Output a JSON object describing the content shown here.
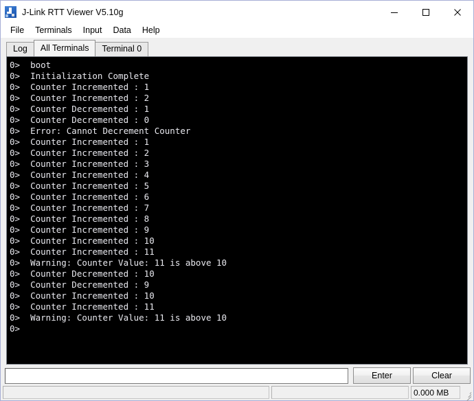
{
  "window": {
    "title": "J-Link RTT Viewer V5.10g",
    "icon": "jlink-logo-icon",
    "controls": {
      "minimize": "minimize-icon",
      "maximize": "maximize-icon",
      "close": "close-icon"
    }
  },
  "menu": {
    "items": [
      {
        "label": "File"
      },
      {
        "label": "Terminals"
      },
      {
        "label": "Input"
      },
      {
        "label": "Data"
      },
      {
        "label": "Help"
      }
    ]
  },
  "tabs": [
    {
      "label": "Log",
      "active": false
    },
    {
      "label": "All Terminals",
      "active": true
    },
    {
      "label": "Terminal 0",
      "active": false
    }
  ],
  "terminal": {
    "background": "#000000",
    "foreground": "#e9e9ef",
    "lines": [
      "0>  boot",
      "0>  Initialization Complete",
      "0>  Counter Incremented : 1",
      "0>  Counter Incremented : 2",
      "0>  Counter Decremented : 1",
      "0>  Counter Decremented : 0",
      "0>  Error: Cannot Decrement Counter",
      "0>  Counter Incremented : 1",
      "0>  Counter Incremented : 2",
      "0>  Counter Incremented : 3",
      "0>  Counter Incremented : 4",
      "0>  Counter Incremented : 5",
      "0>  Counter Incremented : 6",
      "0>  Counter Incremented : 7",
      "0>  Counter Incremented : 8",
      "0>  Counter Incremented : 9",
      "0>  Counter Incremented : 10",
      "0>  Counter Incremented : 11",
      "0>  Warning: Counter Value: 11 is above 10",
      "0>  Counter Decremented : 10",
      "0>  Counter Decremented : 9",
      "0>  Counter Incremented : 10",
      "0>  Counter Incremented : 11",
      "0>  Warning: Counter Value: 11 is above 10",
      "0>"
    ]
  },
  "input": {
    "value": "",
    "placeholder": ""
  },
  "buttons": {
    "enter": "Enter",
    "clear": "Clear"
  },
  "statusbar": {
    "left": "",
    "middle": "",
    "data_size": "0.000 MB"
  }
}
